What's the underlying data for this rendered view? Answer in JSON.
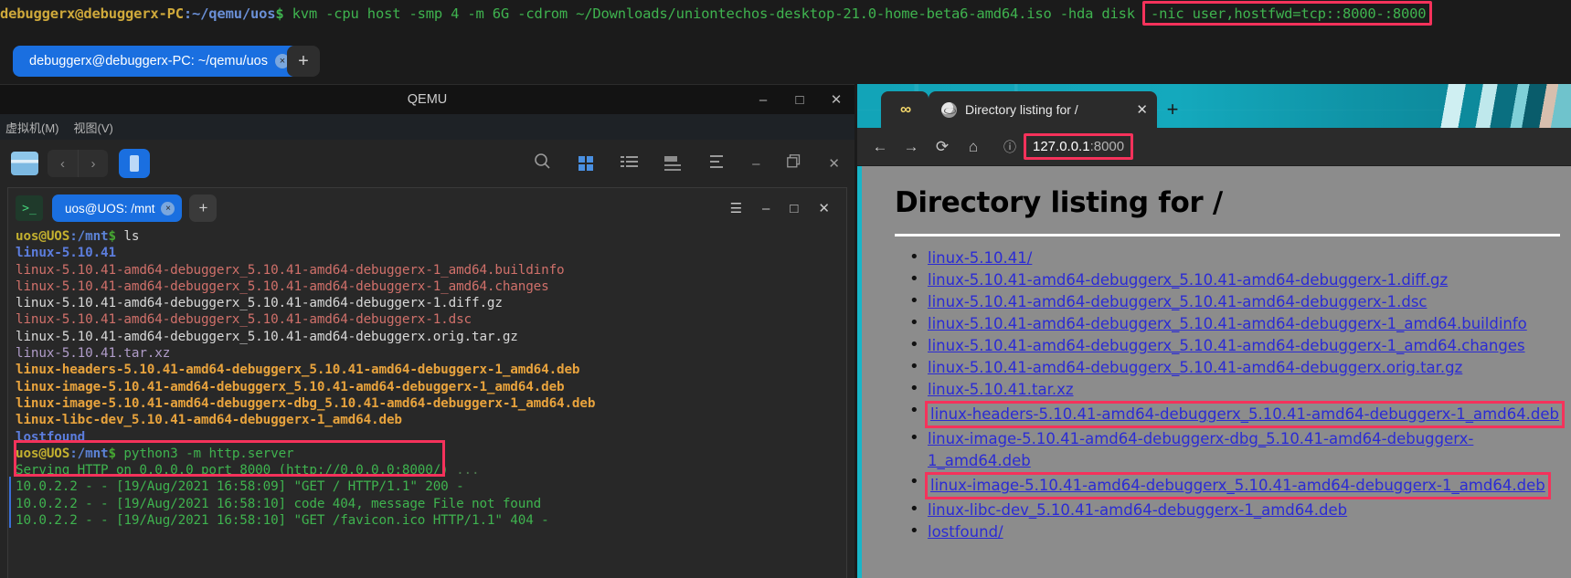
{
  "host": {
    "prompt_user": "debuggerx@debuggerx-PC",
    "prompt_path": ":~/qemu/uos",
    "prompt_dollar": "$ ",
    "command": "kvm -cpu host -smp 4 -m 6G -cdrom ~/Downloads/uniontechos-desktop-21.0-home-beta6-amd64.iso -hda disk ",
    "highlighted_arg": "-nic user,hostfwd=tcp::8000-:8000",
    "tab_label": "debuggerx@debuggerx-PC: ~/qemu/uos",
    "tab_close": "×",
    "new_tab": "+"
  },
  "qemu": {
    "title": "QEMU",
    "minimize": "–",
    "maximize": "□",
    "close": "✕",
    "menu": [
      "虚拟机(M)",
      "视图(V)"
    ],
    "filemanager": {
      "folder_icon": "folder-icon",
      "back": "‹",
      "forward": "›",
      "search_icon": "search-icon",
      "grid_view_icon": "grid-view-icon",
      "list_view_icon": "list-view-icon",
      "detail_view_icon": "detail-view-icon",
      "menu_icon": "menu-icon",
      "minimize": "–",
      "restore": "❐",
      "close": "✕"
    },
    "terminal": {
      "logo": ">_",
      "tab_label": "uos@UOS: /mnt",
      "tab_close": "×",
      "new_tab": "+",
      "menu": "☰",
      "minimize": "–",
      "maximize": "□",
      "close": "✕",
      "prompt_user": "uos@UOS",
      "prompt_path": ":/mnt",
      "prompt_dollar": "$ ",
      "cmd1": "ls",
      "cmd2": "python3 -m http.server",
      "ls_output": [
        {
          "text": "linux-5.10.41",
          "kind": "dir"
        },
        {
          "text": "linux-5.10.41-amd64-debuggerx_5.10.41-amd64-debuggerx-1_amd64.buildinfo",
          "kind": "arch"
        },
        {
          "text": "linux-5.10.41-amd64-debuggerx_5.10.41-amd64-debuggerx-1_amd64.changes",
          "kind": "arch"
        },
        {
          "text": "linux-5.10.41-amd64-debuggerx_5.10.41-amd64-debuggerx-1.diff.gz",
          "kind": "plain"
        },
        {
          "text": "linux-5.10.41-amd64-debuggerx_5.10.41-amd64-debuggerx-1.dsc",
          "kind": "arch"
        },
        {
          "text": "linux-5.10.41-amd64-debuggerx_5.10.41-amd64-debuggerx.orig.tar.gz",
          "kind": "plain"
        },
        {
          "text": "linux-5.10.41.tar.xz",
          "kind": "xz"
        },
        {
          "text": "linux-headers-5.10.41-amd64-debuggerx_5.10.41-amd64-debuggerx-1_amd64.deb",
          "kind": "deb"
        },
        {
          "text": "linux-image-5.10.41-amd64-debuggerx_5.10.41-amd64-debuggerx-1_amd64.deb",
          "kind": "deb"
        },
        {
          "text": "linux-image-5.10.41-amd64-debuggerx-dbg_5.10.41-amd64-debuggerx-1_amd64.deb",
          "kind": "deb"
        },
        {
          "text": "linux-libc-dev_5.10.41-amd64-debuggerx-1_amd64.deb",
          "kind": "deb"
        },
        {
          "text": "lostfound",
          "kind": "dir"
        }
      ],
      "serving_line": "Serving HTTP on 0.0.0.0 port 8000 (http://0.0.0.0:8000/)",
      "serving_tail": " ...",
      "log_lines": [
        "10.0.2.2 - - [19/Aug/2021 16:58:09] \"GET / HTTP/1.1\" 200 -",
        "10.0.2.2 - - [19/Aug/2021 16:58:10] code 404, message File not found",
        "10.0.2.2 - - [19/Aug/2021 16:58:10] \"GET /favicon.ico HTTP/1.1\" 404 -"
      ]
    }
  },
  "browser": {
    "favicon_button": "∞",
    "tab_title": "Directory listing for /",
    "tab_close": "✕",
    "new_tab": "+",
    "back": "←",
    "forward": "→",
    "reload": "⟳",
    "home": "⌂",
    "site_info": "ⓘ",
    "url_host": "127.0.0.1",
    "url_port": ":8000",
    "page": {
      "heading": "Directory listing for /",
      "links": [
        {
          "text": "linux-5.10.41/",
          "boxed": false
        },
        {
          "text": "linux-5.10.41-amd64-debuggerx_5.10.41-amd64-debuggerx-1.diff.gz",
          "boxed": false
        },
        {
          "text": "linux-5.10.41-amd64-debuggerx_5.10.41-amd64-debuggerx-1.dsc",
          "boxed": false
        },
        {
          "text": "linux-5.10.41-amd64-debuggerx_5.10.41-amd64-debuggerx-1_amd64.buildinfo",
          "boxed": false
        },
        {
          "text": "linux-5.10.41-amd64-debuggerx_5.10.41-amd64-debuggerx-1_amd64.changes",
          "boxed": false
        },
        {
          "text": "linux-5.10.41-amd64-debuggerx_5.10.41-amd64-debuggerx.orig.tar.gz",
          "boxed": false
        },
        {
          "text": "linux-5.10.41.tar.xz",
          "boxed": false
        },
        {
          "text": "linux-headers-5.10.41-amd64-debuggerx_5.10.41-amd64-debuggerx-1_amd64.deb",
          "boxed": true
        },
        {
          "text": "linux-image-5.10.41-amd64-debuggerx-dbg_5.10.41-amd64-debuggerx-1_amd64.deb",
          "boxed": false
        },
        {
          "text": "linux-image-5.10.41-amd64-debuggerx_5.10.41-amd64-debuggerx-1_amd64.deb",
          "boxed": true
        },
        {
          "text": "linux-libc-dev_5.10.41-amd64-debuggerx-1_amd64.deb",
          "boxed": false
        },
        {
          "text": "lostfound/",
          "boxed": false
        }
      ]
    }
  },
  "colors": {
    "highlight": "#f5325b",
    "accent_blue": "#1a6fe0",
    "browser_teal": "#17b6c9",
    "term_green": "#3fb34f"
  }
}
